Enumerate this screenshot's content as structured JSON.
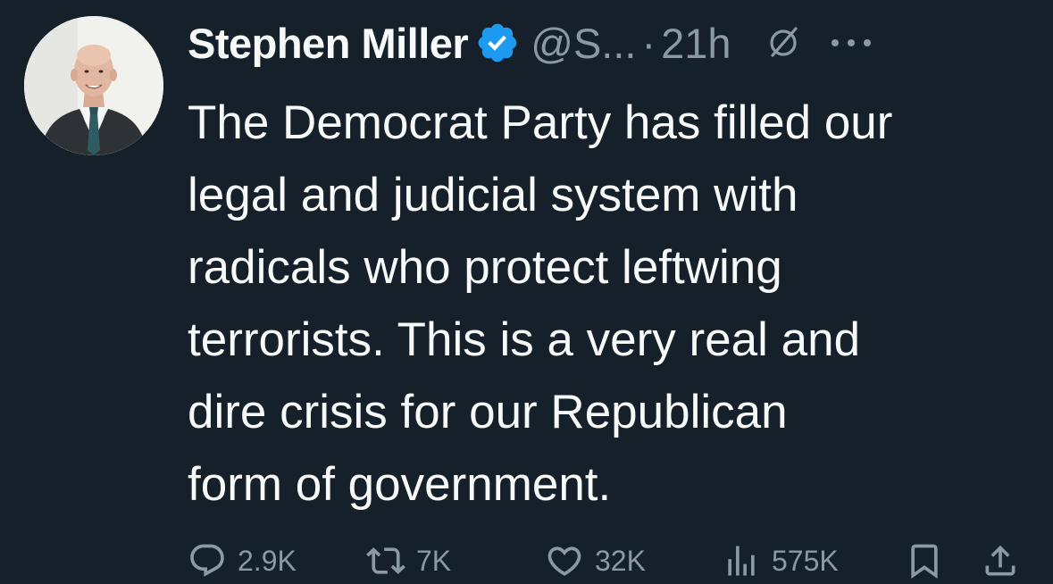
{
  "tweet": {
    "author": {
      "display_name": "Stephen Miller",
      "handle": "@S...",
      "verified": true
    },
    "separator": "·",
    "timestamp": "21h",
    "text_lines": [
      "The Democrat Party has filled our",
      "legal and judicial system with",
      "radicals who protect leftwing",
      "terrorists. This is a very real and",
      "dire crisis for our Republican",
      "form of government."
    ],
    "metrics": {
      "replies": "2.9K",
      "reposts": "7K",
      "likes": "32K",
      "views": "575K"
    }
  },
  "icons": {
    "verified": "verified-badge-icon",
    "grok": "grok-icon",
    "more": "more-icon",
    "reply": "reply-icon",
    "repost": "repost-icon",
    "like": "heart-icon",
    "views": "views-chart-icon",
    "bookmark": "bookmark-icon",
    "share": "share-icon"
  },
  "colors": {
    "background": "#15202b",
    "primary_text": "#f7f9f9",
    "secondary_text": "#8b98a5",
    "verified_blue": "#1d9bf0"
  }
}
